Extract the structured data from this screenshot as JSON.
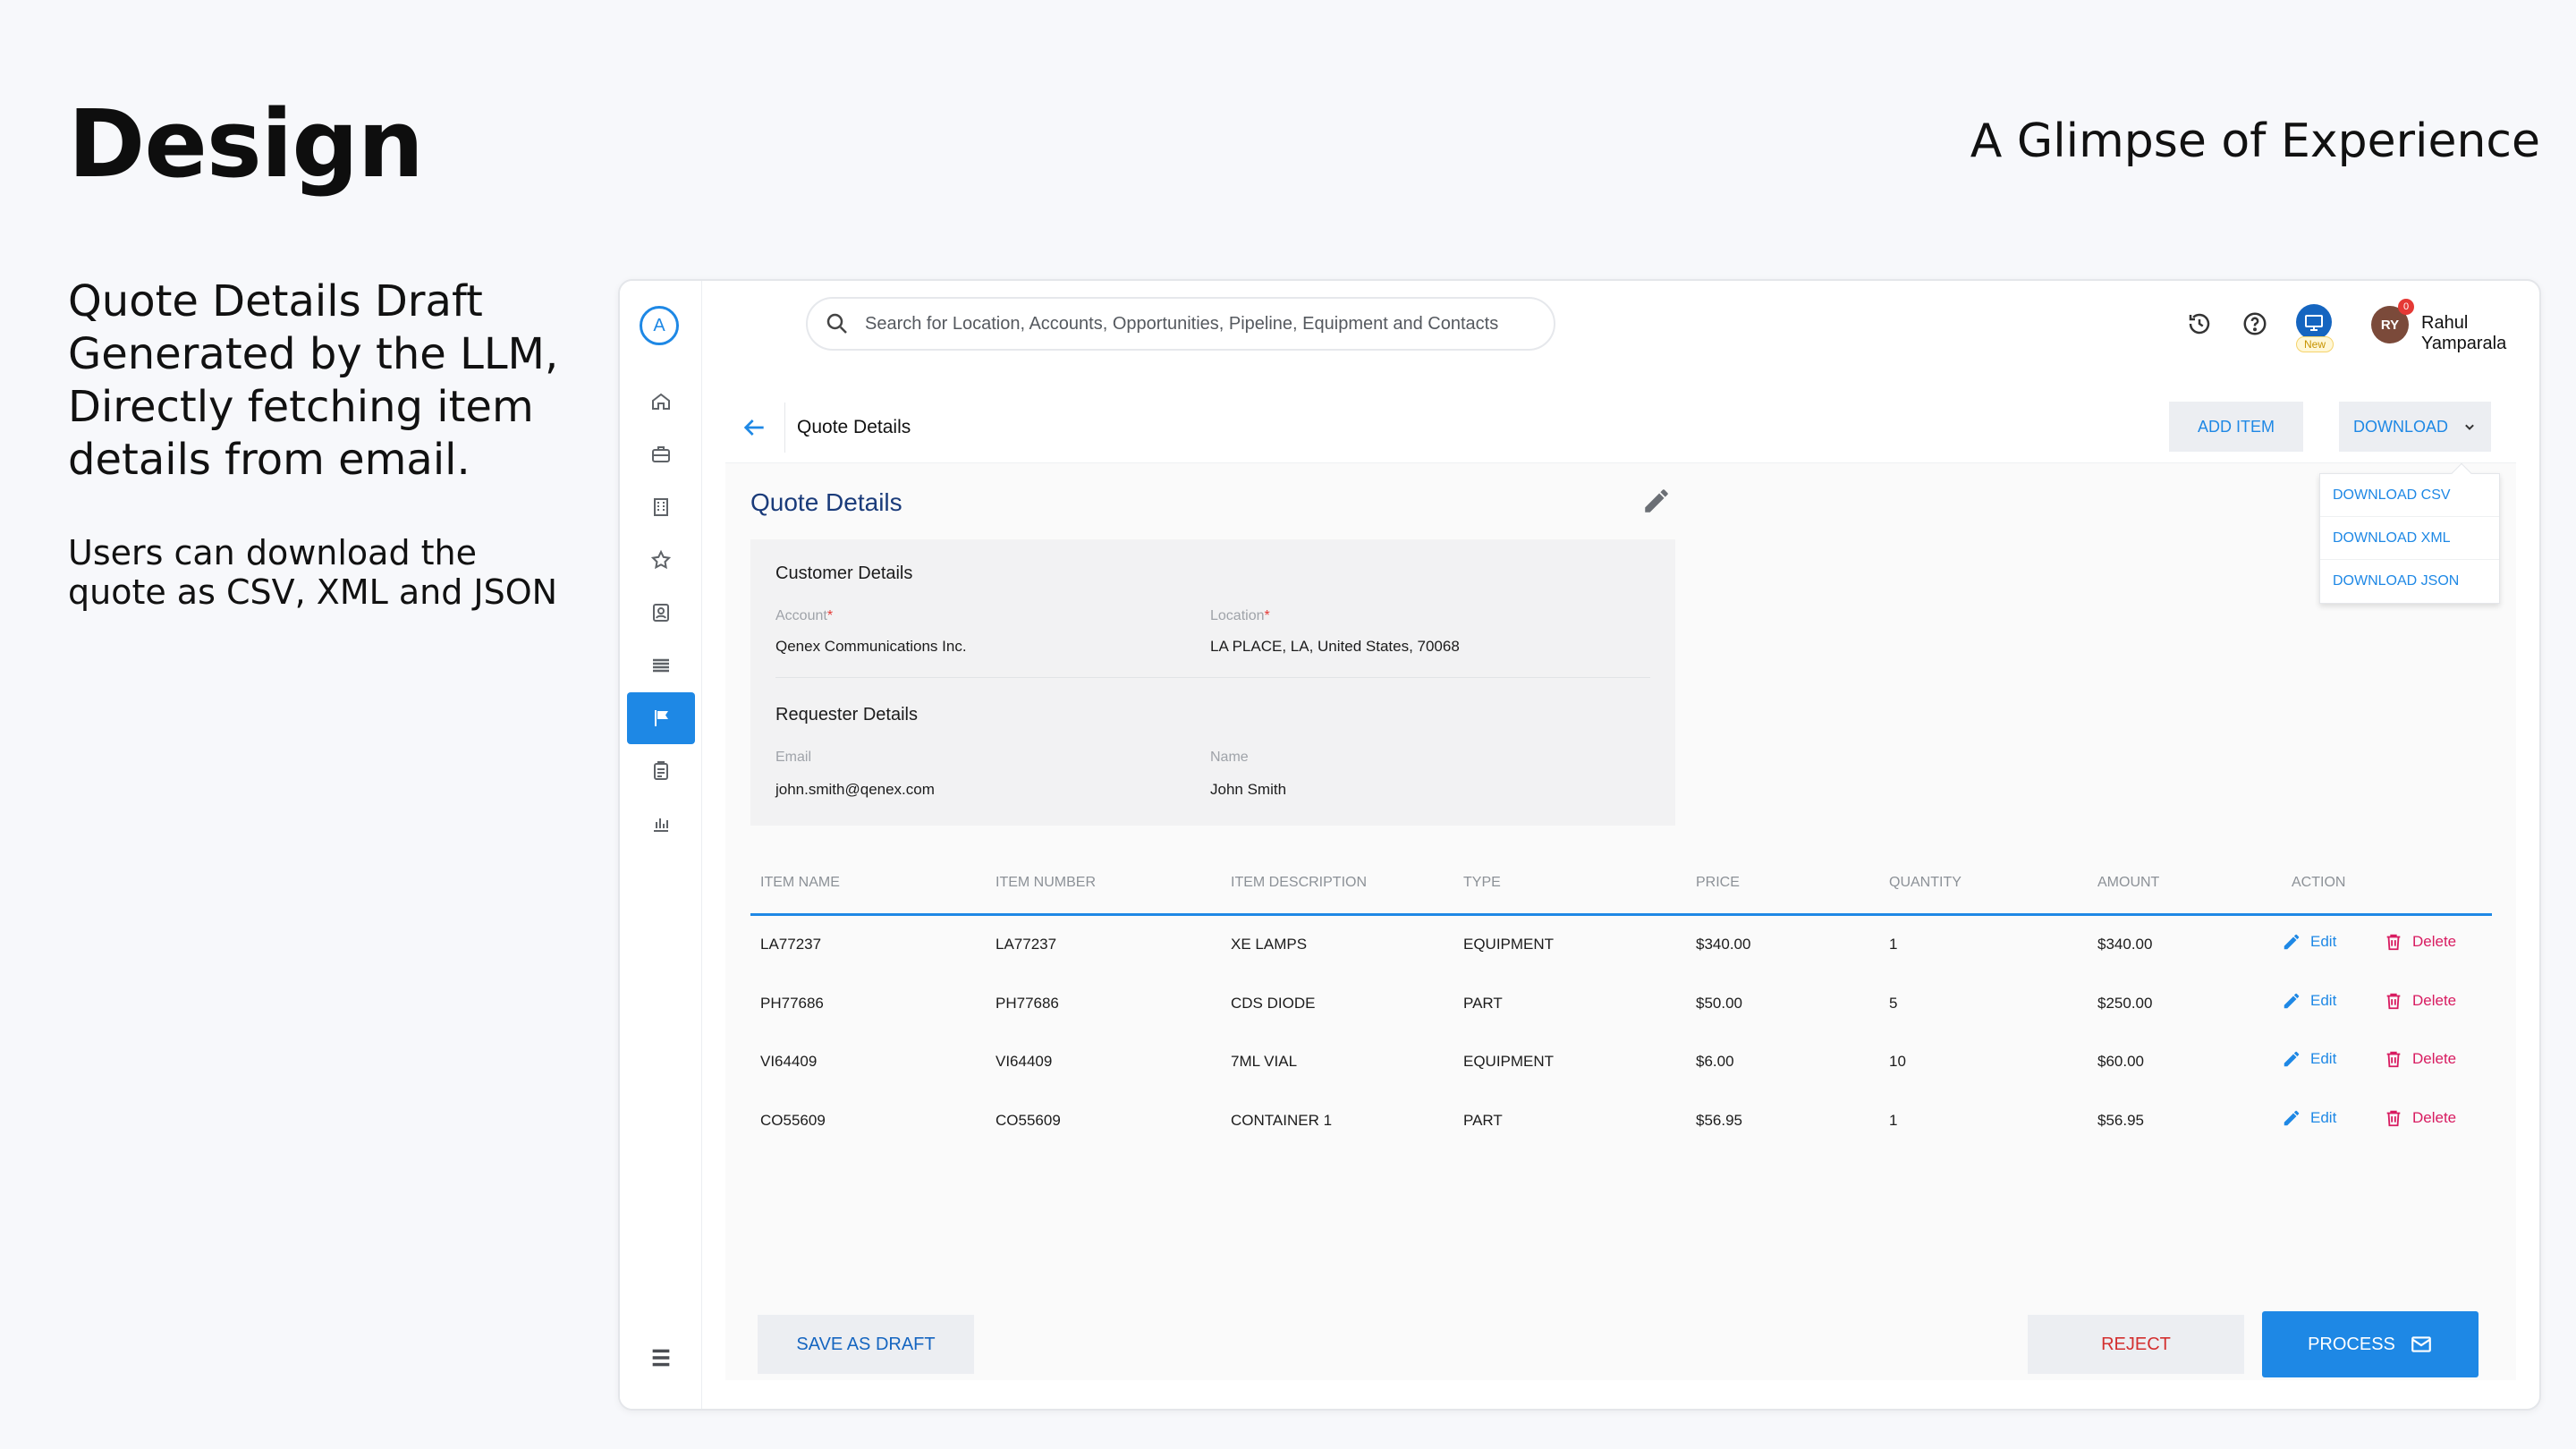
{
  "slide": {
    "title": "Design",
    "tagline": "A Glimpse of Experience",
    "description": "Quote Details Draft Generated by the LLM, Directly fetching item details from email.",
    "subdescription": "Users can download the quote as CSV, XML and JSON"
  },
  "app": {
    "logo_letter": "A",
    "search": {
      "placeholder": "Search for Location, Accounts, Opportunities, Pipeline, Equipment and Contacts"
    },
    "topbar": {
      "new_badge": "New",
      "notification_count": "0",
      "user_initials": "RY",
      "user_name": "Rahul Yamparala"
    },
    "nav_icons": [
      "home-icon",
      "briefcase-icon",
      "building-icon",
      "star-icon",
      "contact-icon",
      "list-icon",
      "flag-icon",
      "clipboard-icon",
      "chart-icon"
    ],
    "header": {
      "title": "Quote Details",
      "add_item_label": "ADD ITEM",
      "download_label": "DOWNLOAD",
      "download_options": [
        "DOWNLOAD CSV",
        "DOWNLOAD XML",
        "DOWNLOAD JSON"
      ]
    },
    "details": {
      "title": "Quote Details",
      "customer": {
        "title": "Customer Details",
        "account_label": "Account",
        "account_value": "Qenex Communications Inc.",
        "location_label": "Location",
        "location_value": "LA PLACE, LA, United States, 70068"
      },
      "requester": {
        "title": "Requester Details",
        "email_label": "Email",
        "email_value": "john.smith@qenex.com",
        "name_label": "Name",
        "name_value": "John Smith"
      }
    },
    "table": {
      "columns": [
        "ITEM NAME",
        "ITEM NUMBER",
        "ITEM DESCRIPTION",
        "TYPE",
        "PRICE",
        "QUANTITY",
        "AMOUNT",
        "ACTION"
      ],
      "edit_label": "Edit",
      "delete_label": "Delete",
      "rows": [
        [
          "LA77237",
          "LA77237",
          "XE LAMPS",
          "EQUIPMENT",
          "$340.00",
          "1",
          "$340.00"
        ],
        [
          "PH77686",
          "PH77686",
          "CDS DIODE",
          "PART",
          "$50.00",
          "5",
          "$250.00"
        ],
        [
          "VI64409",
          "VI64409",
          "7ML VIAL",
          "EQUIPMENT",
          "$6.00",
          "10",
          "$60.00"
        ],
        [
          "CO55609",
          "CO55609",
          "CONTAINER 1",
          "PART",
          "$56.95",
          "1",
          "$56.95"
        ]
      ]
    },
    "footer": {
      "draft_label": "SAVE AS DRAFT",
      "reject_label": "REJECT",
      "process_label": "PROCESS"
    },
    "colors": {
      "primary": "#1e88e5",
      "title": "#1a3b7a",
      "danger": "#d32f2f",
      "delete": "#d81b60"
    }
  }
}
